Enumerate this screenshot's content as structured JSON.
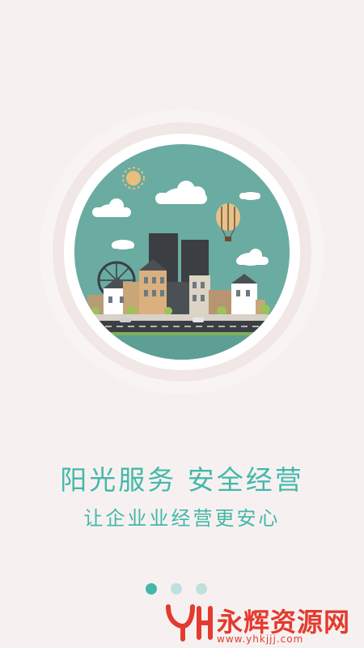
{
  "headline": "阳光服务 安全经营",
  "subline": "让企业业经营更安心",
  "pager": {
    "total": 3,
    "active_index": 0
  },
  "colors": {
    "accent": "#43b8a9",
    "background": "#f6f1f0",
    "watermark": "#e43a2f"
  },
  "watermark": {
    "text": "永辉资源网",
    "url": "www.yhkjjj.com"
  }
}
